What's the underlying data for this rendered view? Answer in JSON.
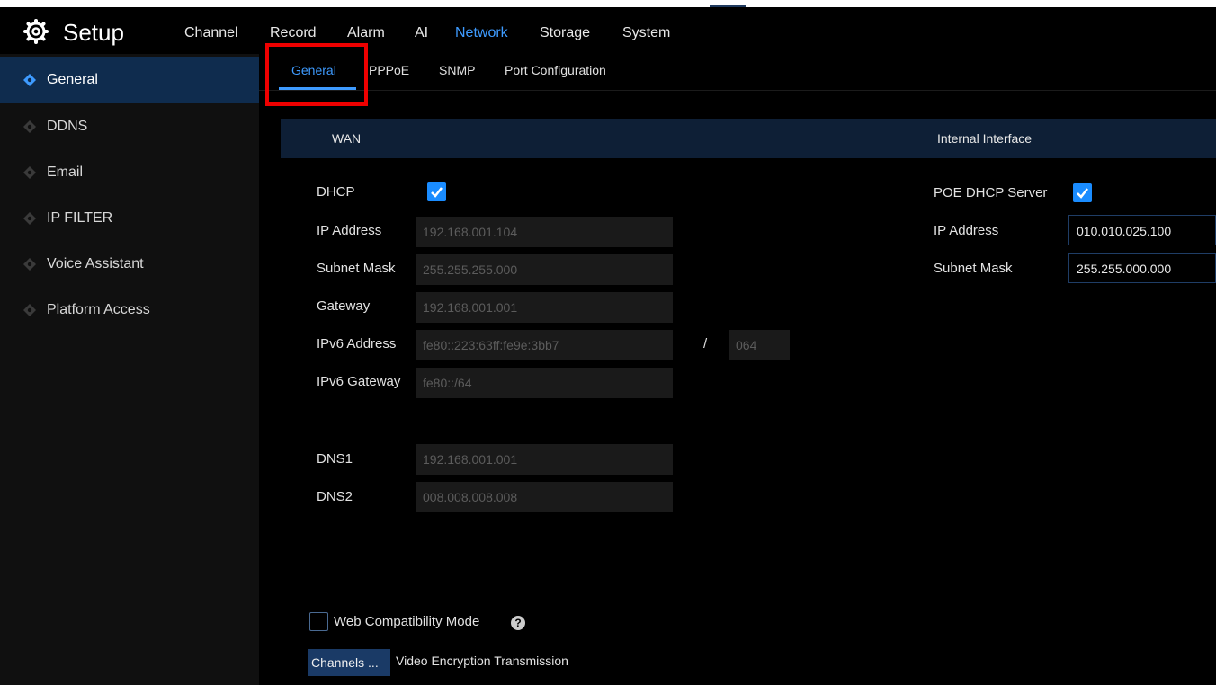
{
  "header": {
    "title": "Setup",
    "nav_tabs": [
      "Channel",
      "Record",
      "Alarm",
      "AI",
      "Network",
      "Storage",
      "System"
    ],
    "active_tab": "Network"
  },
  "sidebar": {
    "items": [
      {
        "label": "General"
      },
      {
        "label": "DDNS"
      },
      {
        "label": "Email"
      },
      {
        "label": "IP FILTER"
      },
      {
        "label": "Voice Assistant"
      },
      {
        "label": "Platform Access"
      }
    ],
    "active": "General"
  },
  "subtabs": {
    "items": [
      "General",
      "PPPoE",
      "SNMP",
      "Port Configuration"
    ],
    "active": "General"
  },
  "wan": {
    "section_title": "WAN",
    "dhcp_label": "DHCP",
    "dhcp_checked": true,
    "ip_label": "IP Address",
    "ip_value": "192.168.001.104",
    "subnet_label": "Subnet Mask",
    "subnet_value": "255.255.255.000",
    "gateway_label": "Gateway",
    "gateway_value": "192.168.001.001",
    "ipv6_label": "IPv6 Address",
    "ipv6_value": "fe80::223:63ff:fe9e:3bb7",
    "ipv6_sep": "/",
    "ipv6_prefix": "064",
    "ipv6_gw_label": "IPv6 Gateway",
    "ipv6_gw_value": "fe80::/64",
    "dns1_label": "DNS1",
    "dns1_value": "192.168.001.001",
    "dns2_label": "DNS2",
    "dns2_value": "008.008.008.008"
  },
  "internal": {
    "section_title": "Internal Interface",
    "poe_label": "POE DHCP Server",
    "poe_checked": true,
    "ip_label": "IP Address",
    "ip_value": "010.010.025.100",
    "subnet_label": "Subnet Mask",
    "subnet_value": "255.255.000.000"
  },
  "footer": {
    "web_compat_label": "Web Compatibility Mode",
    "web_compat_checked": false,
    "help_glyph": "?",
    "channels_button": "Channels ...",
    "encryption_label": "Video Encryption Transmission"
  },
  "colors": {
    "accent": "#3e9bff",
    "checkbox": "#1a8cff",
    "highlight_box": "#ee0000",
    "sidebar_active": "#0f2c4e",
    "section_bar": "#0e1f36"
  },
  "icons": {
    "setup": "gear-icon",
    "sidebar_bullet": "diamond-bullet-icon",
    "checkbox": "checkmark-icon",
    "help": "help-icon"
  }
}
